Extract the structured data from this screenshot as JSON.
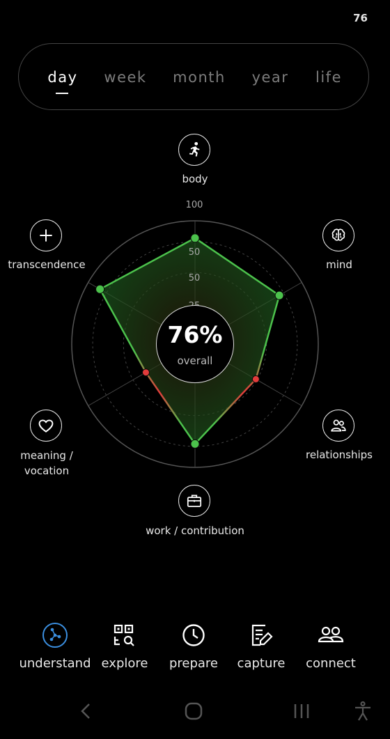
{
  "status": {
    "number": "76"
  },
  "period_tabs": [
    {
      "label": "day",
      "active": true
    },
    {
      "label": "week",
      "active": false
    },
    {
      "label": "month",
      "active": false
    },
    {
      "label": "year",
      "active": false
    },
    {
      "label": "life",
      "active": false
    }
  ],
  "radar": {
    "scale_labels": [
      "100",
      "50",
      "50",
      "25"
    ],
    "overall": {
      "value": "76%",
      "label": "overall"
    },
    "dimensions": [
      {
        "label": "body",
        "icon": "running-person-icon",
        "value": 0.86,
        "status": "good"
      },
      {
        "label": "mind",
        "icon": "brain-icon",
        "value": 0.79,
        "status": "good"
      },
      {
        "label": "relationships",
        "icon": "people-icon",
        "value": 0.57,
        "status": "bad"
      },
      {
        "label": "work / contribution",
        "icon": "briefcase-icon",
        "value": 0.81,
        "status": "good"
      },
      {
        "label": "meaning / vocation",
        "icon": "heart-icon",
        "value": 0.46,
        "status": "bad"
      },
      {
        "label": "transcendence",
        "icon": "plus-icon",
        "value": 0.89,
        "status": "good"
      }
    ],
    "colors": {
      "good": "#4cc24c",
      "bad": "#e23b3b",
      "grid": "#444444"
    }
  },
  "bottom_nav": [
    {
      "label": "understand",
      "icon": "network-icon",
      "active": true
    },
    {
      "label": "explore",
      "icon": "qr-search-icon",
      "active": false
    },
    {
      "label": "prepare",
      "icon": "clock-icon",
      "active": false
    },
    {
      "label": "capture",
      "icon": "note-edit-icon",
      "active": false
    },
    {
      "label": "connect",
      "icon": "group-icon",
      "active": false
    }
  ],
  "accent_color": "#3b8fe0"
}
